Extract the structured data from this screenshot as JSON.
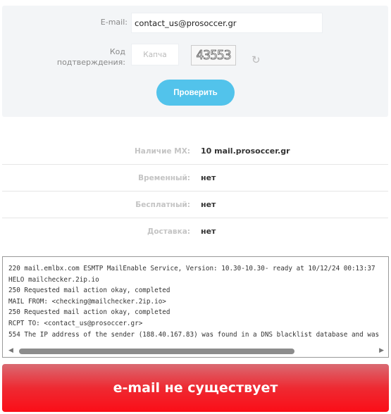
{
  "form": {
    "email_label": "E-mail:",
    "email_value": "contact_us@prosoccer.gr",
    "code_label_1": "Код",
    "code_label_2": "подтверждения:",
    "captcha_placeholder": "Капча",
    "captcha_text": "43553",
    "submit_label": "Проверить",
    "accent": "#52c3eb"
  },
  "results": [
    {
      "label": "Наличие MX:",
      "value": "10 mail.prosoccer.gr"
    },
    {
      "label": "Временный:",
      "value": "нет"
    },
    {
      "label": "Бесплатный:",
      "value": "нет"
    },
    {
      "label": "Доставка:",
      "value": "нет"
    }
  ],
  "log": {
    "lines": [
      "220 mail.emlbx.com ESMTP MailEnable Service, Version: 10.30-10.30- ready at 10/12/24 00:13:37",
      "HELO mailchecker.2ip.io",
      "250 Requested mail action okay, completed",
      "MAIL FROM: <checking@mailchecker.2ip.io>",
      "250 Requested mail action okay, completed",
      "RCPT TO: <contact_us@prosoccer.gr>",
      "554 The IP address of the sender (188.40.167.83) was found in a DNS blacklist database and was"
    ]
  },
  "status": {
    "text": "e-mail не существует",
    "color": "#ee2a32"
  }
}
